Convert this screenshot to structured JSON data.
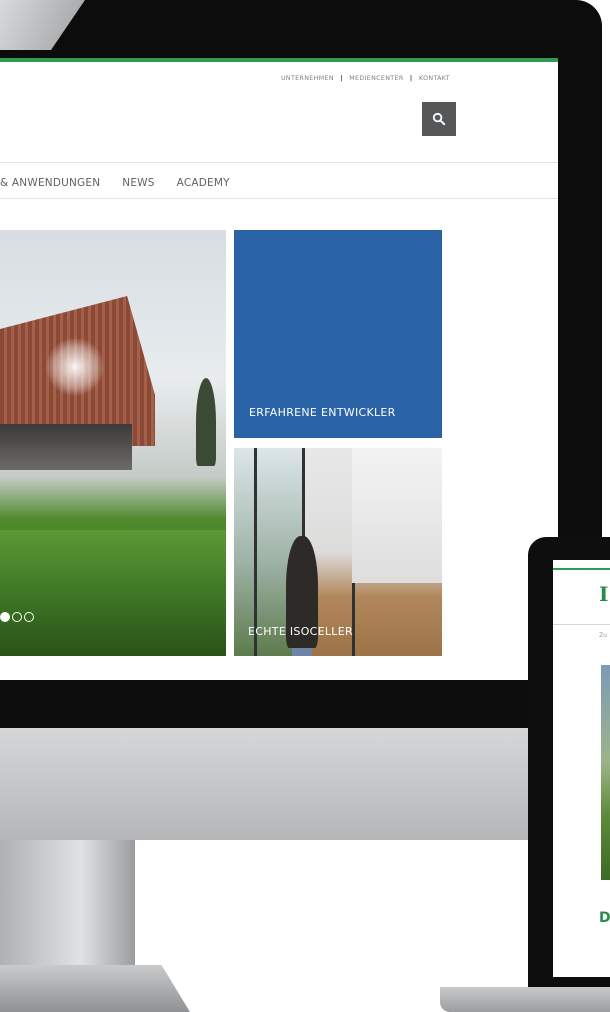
{
  "meta_nav": {
    "item1": "UNTERNEHMEN",
    "sep": "|",
    "item2": "MEDIENCENTER",
    "item3": "KONTAKT"
  },
  "main_nav": {
    "item1": "& ANWENDUNGEN",
    "item2": "NEWS",
    "item3": "ACADEMY"
  },
  "search": {
    "icon": "search-icon"
  },
  "hero": {
    "slider_dots": 3,
    "active_dot": 1
  },
  "tiles": {
    "blue": {
      "label": "ERFAHRENE ENTWICKLER",
      "color": "#2a62a7"
    },
    "office": {
      "label": "ECHTE ISOCELLER"
    }
  },
  "colors": {
    "accent": "#2e9c52",
    "search_bg": "#555759"
  },
  "laptop": {
    "logo_fragment": "I",
    "nav_fragment": "Zu",
    "heading_fragment": "D"
  }
}
